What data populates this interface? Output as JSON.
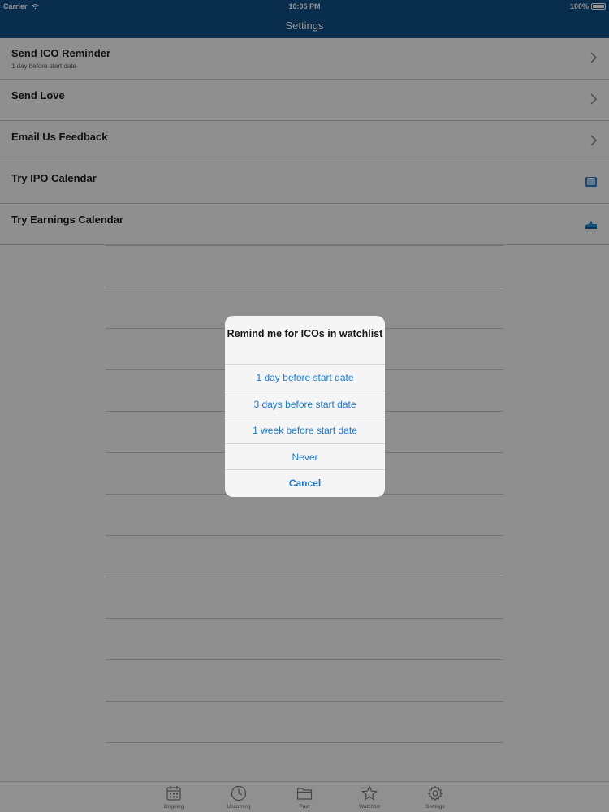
{
  "status_bar": {
    "carrier": "Carrier",
    "time": "10:05 PM",
    "battery": "100%"
  },
  "nav": {
    "title": "Settings"
  },
  "settings": {
    "items": [
      {
        "title": "Send ICO Reminder",
        "subtitle": "1 day before start date",
        "accessory": "chevron-right-icon"
      },
      {
        "title": "Send Love",
        "accessory": "chevron-right-icon"
      },
      {
        "title": "Email Us Feedback",
        "accessory": "chevron-right-icon"
      },
      {
        "title": "Try IPO Calendar",
        "accessory": "ipo-calendar-app-icon"
      },
      {
        "title": "Try Earnings Calendar",
        "accessory": "earnings-calendar-app-icon"
      }
    ]
  },
  "action_sheet": {
    "title": "Remind me for ICOs in watchlist",
    "options": [
      "1 day before start date",
      "3 days before start date",
      "1 week before start date",
      "Never"
    ],
    "cancel": "Cancel"
  },
  "tab_bar": {
    "tabs": [
      {
        "label": "Ongoing",
        "icon": "calendar-icon"
      },
      {
        "label": "Upcoming",
        "icon": "clock-icon"
      },
      {
        "label": "Past",
        "icon": "folder-icon"
      },
      {
        "label": "Watchlist",
        "icon": "star-icon"
      },
      {
        "label": "Settings",
        "icon": "gear-icon"
      }
    ]
  },
  "colors": {
    "nav_background": "#0f4f86",
    "accent": "#1d78d6"
  }
}
